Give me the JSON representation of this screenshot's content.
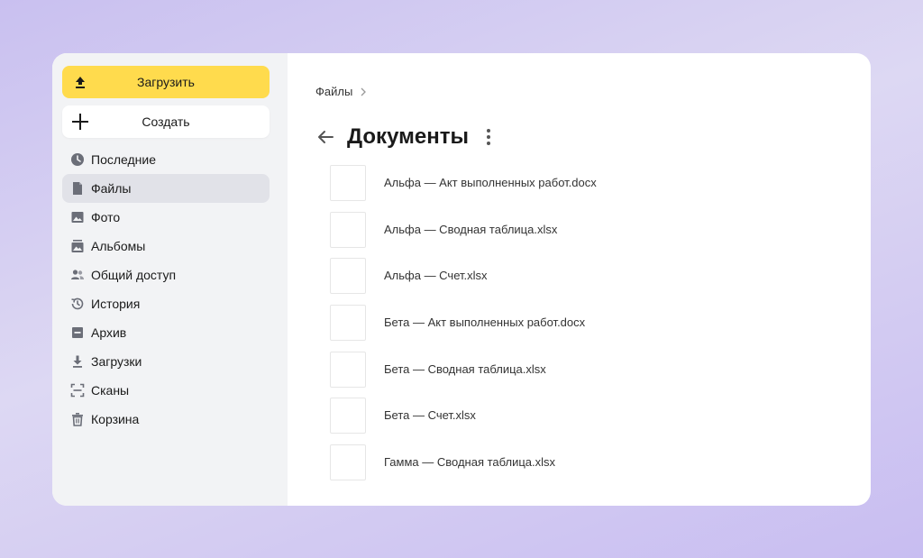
{
  "colors": {
    "accent": "#ffdb4d",
    "sidebar_bg": "#f2f3f5",
    "active_bg": "#e1e2e8",
    "icon": "#6b6e78"
  },
  "sidebar": {
    "upload_label": "Загрузить",
    "create_label": "Создать",
    "items": [
      {
        "label": "Последние",
        "icon": "clock-icon"
      },
      {
        "label": "Файлы",
        "icon": "file-icon",
        "active": true
      },
      {
        "label": "Фото",
        "icon": "image-icon"
      },
      {
        "label": "Альбомы",
        "icon": "album-icon"
      },
      {
        "label": "Общий доступ",
        "icon": "shared-users-icon"
      },
      {
        "label": "История",
        "icon": "history-icon"
      },
      {
        "label": "Архив",
        "icon": "archive-icon"
      },
      {
        "label": "Загрузки",
        "icon": "download-icon"
      },
      {
        "label": "Сканы",
        "icon": "scan-icon"
      },
      {
        "label": "Корзина",
        "icon": "trash-icon"
      }
    ]
  },
  "main": {
    "breadcrumb": [
      "Файлы"
    ],
    "title": "Документы",
    "files": [
      {
        "name": "Альфа — Акт выполненных работ.docx"
      },
      {
        "name": "Альфа — Сводная таблица.xlsx"
      },
      {
        "name": "Альфа — Счет.xlsx"
      },
      {
        "name": "Бета — Акт выполненных работ.docx"
      },
      {
        "name": "Бета — Сводная таблица.xlsx"
      },
      {
        "name": "Бета — Счет.xlsx"
      },
      {
        "name": "Гамма — Сводная таблица.xlsx"
      }
    ]
  }
}
